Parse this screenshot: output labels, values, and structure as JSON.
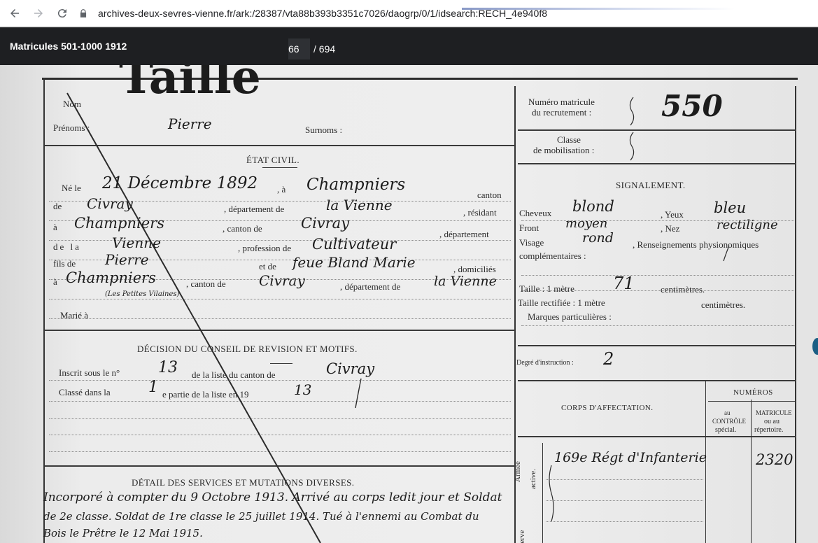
{
  "browser": {
    "url": "archives-deux-sevres-vienne.fr/ark:/28387/vta88b393b3351c7026/daogrp/0/1/idsearch:RECH_4e940f8"
  },
  "viewer": {
    "title": "Matricules 501-1000 1912",
    "current_page": "66",
    "total_pages": "/ 694"
  },
  "document": {
    "surname_hand": "Taillé",
    "nom_label": "Nom",
    "prenoms_label": "Prénoms :",
    "prenom_hand": "Pierre",
    "surnoms_label": "Surnoms :",
    "matricule_label_1": "Numéro matricule",
    "matricule_label_2": "du recrutement :",
    "matricule_hand": "550",
    "classe_label_1": "Classe",
    "classe_label_2": "de mobilisation :",
    "etat_civil_heading": "ÉTAT CIVIL.",
    "ne_le": "Né le",
    "birth_date_hand": "21 Décembre 1892",
    "a_label": ", à",
    "birth_place_hand": "Champniers",
    "canton_label": "canton",
    "de_label": "de",
    "canton_hand": "Civray",
    "departement_de": ", département de",
    "dept_hand": "la Vienne",
    "residant": ", résidant",
    "a2": "à",
    "residence_hand": "Champniers",
    "canton_de": ", canton de",
    "canton2_hand": "Civray",
    "departement": ", département",
    "de_la": "de la",
    "dept2_hand": "Vienne",
    "profession_de": ", profession de",
    "profession_hand": "Cultivateur",
    "fils_de": "fils de",
    "father_hand": "Pierre",
    "et_de": "et de",
    "mother_hand": "feue Bland Marie",
    "domicilies": ", domiciliés",
    "a3": "à",
    "domicile_hand": "Champniers",
    "domicile_note_hand": "(Les Petites Vilaines)",
    "canton_de2": ", canton de",
    "canton3_hand": "Civray",
    "departement_de2": ", département de",
    "dept3_hand": "la Vienne",
    "marie_a": "Marié à",
    "signalement_heading": "SIGNALEMENT.",
    "cheveux_label": "Cheveux",
    "cheveux_hand": "blond",
    "yeux_label": ", Yeux",
    "yeux_hand": "bleu",
    "front_label": "Front",
    "front_hand": "moyen",
    "nez_label": ", Nez",
    "nez_hand": "rectiligne",
    "visage_label": "Visage",
    "visage_hand": "rond",
    "renseignements_label": ", Renseignements physionomiques",
    "complementaires_label": "complémentaires :",
    "taille_label": "Taille : 1 mètre",
    "taille_hand": "71",
    "centimetres_label": "centimètres.",
    "taille_rectifiee_label": "Taille rectifiée : 1 mètre",
    "centimetres_label_2": "centimètres.",
    "marques_label": "Marques particulières :",
    "degre_label": "Degré d'instruction :",
    "degre_hand": "2",
    "decision_heading": "DÉCISION DU CONSEIL DE REVISION ET MOTIFS.",
    "inscrit_label": "Inscrit sous le n°",
    "inscrit_hand": "13",
    "liste_label": "de la liste du canton de",
    "liste_canton_hand": "Civray",
    "classe_dans_label": "Classé dans la",
    "classe_dans_hand": "1",
    "partie_label": "e partie de la liste en 19",
    "partie_year_hand": "13",
    "numeros_heading": "NUMÉROS",
    "corps_heading": "CORPS D'AFFECTATION.",
    "au_controle_1": "au",
    "au_controle_2": "CONTRÔLE",
    "au_controle_3": "spécial.",
    "matricule_col_1": "MATRICULE",
    "matricule_col_2": "ou au",
    "matricule_col_3": "répertoire.",
    "armee_active_1": "Armée",
    "armee_active_2": "active.",
    "reserve_label": "Réserve",
    "corps_hand": "169e Régt d'Infanterie",
    "corps_number_hand": "2320",
    "detail_heading": "DÉTAIL DES SERVICES ET MUTATIONS DIVERSES.",
    "detail_line_1": "Incorporé à compter du 9 Octobre 1913. Arrivé au corps ledit jour et Soldat",
    "detail_line_2": "de 2e classe. Soldat de 1re classe le 25 juillet 1914. Tué à l'ennemi au Combat du",
    "detail_line_3": "Bois le Prêtre le 12 Mai 1915."
  },
  "colors": {
    "viewer_bar": "#1e1f22",
    "page_box": "#2e3034",
    "paper": "#ececec",
    "ink": "#1c1c1c"
  }
}
